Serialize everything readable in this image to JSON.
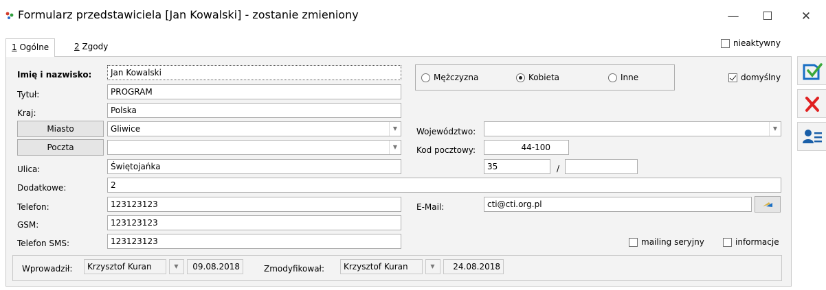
{
  "window": {
    "title": "Formularz przedstawiciela [Jan Kowalski] - zostanie zmieniony",
    "minimize": "—",
    "maximize": "☐",
    "close": "✕"
  },
  "inactive_label": "nieaktywny",
  "tabs": [
    {
      "hotkey": "1",
      "label": " Ogólne"
    },
    {
      "hotkey": "2",
      "label": " Zgody"
    }
  ],
  "form": {
    "name_label": "Imię i nazwisko:",
    "name_value": "Jan Kowalski",
    "title_label": "Tytuł:",
    "title_value": "PROGRAM",
    "country_label": "Kraj:",
    "country_value": "Polska",
    "city_button": "Miasto",
    "city_value": "Gliwice",
    "post_button": "Poczta",
    "post_value": "",
    "street_label": "Ulica:",
    "street_value": "Świętojańka",
    "extra_label": "Dodatkowe:",
    "extra_value": "2",
    "phone_label": "Telefon:",
    "phone_value": "123123123",
    "gsm_label": "GSM:",
    "gsm_value": "123123123",
    "sms_label": "Telefon SMS:",
    "sms_value": "123123123",
    "voivodeship_label": "Województwo:",
    "voivodeship_value": "",
    "postcode_label": "Kod pocztowy:",
    "postcode_value": "44-100",
    "house_no": "35",
    "separator": "/",
    "apartment_no": "",
    "email_label": "E-Mail:",
    "email_value": "cti@cti.org.pl"
  },
  "gender": {
    "options": [
      "Mężczyzna",
      "Kobieta",
      "Inne"
    ],
    "selected": "Kobieta"
  },
  "default_label": "domyślny",
  "mailing_label": "mailing seryjny",
  "info_label": "informacje",
  "footer": {
    "entered_label": "Wprowadził:",
    "entered_by": "Krzysztof Kuran",
    "entered_date": "09.08.2018",
    "modified_label": "Zmodyfikował:",
    "modified_by": "Krzysztof Kuran",
    "modified_date": "24.08.2018"
  },
  "colors": {
    "save_icon": "#1a6fc4",
    "save_check": "#3aa83a",
    "cancel_icon": "#e02020",
    "contact_icon": "#1a5fa8"
  }
}
